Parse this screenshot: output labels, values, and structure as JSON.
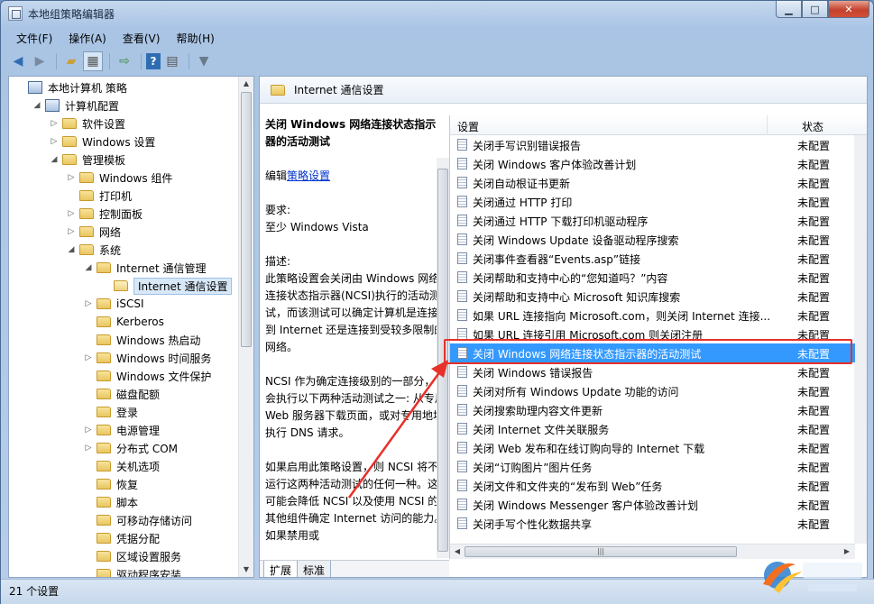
{
  "window": {
    "title": "本地组策略编辑器",
    "caption_buttons": [
      "minimize",
      "maximize",
      "close"
    ]
  },
  "menu": [
    "文件(F)",
    "操作(A)",
    "查看(V)",
    "帮助(H)"
  ],
  "toolbar": {
    "icons": [
      "back-icon",
      "forward-icon",
      "up-folder-icon",
      "show-tree-icon",
      "export-icon",
      "help-icon",
      "properties-icon",
      "filter-icon"
    ]
  },
  "tree": [
    {
      "label": "本地计算机 策略",
      "level": 0,
      "arrow": "",
      "icon": "computer"
    },
    {
      "label": "计算机配置",
      "level": 1,
      "arrow": "open",
      "icon": "computer"
    },
    {
      "label": "软件设置",
      "level": 2,
      "arrow": "closed",
      "icon": "folder"
    },
    {
      "label": "Windows 设置",
      "level": 2,
      "arrow": "closed",
      "icon": "folder"
    },
    {
      "label": "管理模板",
      "level": 2,
      "arrow": "open",
      "icon": "folder"
    },
    {
      "label": "Windows 组件",
      "level": 3,
      "arrow": "closed",
      "icon": "folder"
    },
    {
      "label": "打印机",
      "level": 3,
      "arrow": "",
      "icon": "folder"
    },
    {
      "label": "控制面板",
      "level": 3,
      "arrow": "closed",
      "icon": "folder"
    },
    {
      "label": "网络",
      "level": 3,
      "arrow": "closed",
      "icon": "folder"
    },
    {
      "label": "系统",
      "level": 3,
      "arrow": "open",
      "icon": "folder"
    },
    {
      "label": "Internet 通信管理",
      "level": 4,
      "arrow": "open",
      "icon": "folder"
    },
    {
      "label": "Internet 通信设置",
      "level": 5,
      "arrow": "",
      "icon": "folder-open",
      "selected": true
    },
    {
      "label": "iSCSI",
      "level": 4,
      "arrow": "closed",
      "icon": "folder"
    },
    {
      "label": "Kerberos",
      "level": 4,
      "arrow": "",
      "icon": "folder"
    },
    {
      "label": "Windows 热启动",
      "level": 4,
      "arrow": "",
      "icon": "folder"
    },
    {
      "label": "Windows 时间服务",
      "level": 4,
      "arrow": "closed",
      "icon": "folder"
    },
    {
      "label": "Windows 文件保护",
      "level": 4,
      "arrow": "",
      "icon": "folder"
    },
    {
      "label": "磁盘配额",
      "level": 4,
      "arrow": "",
      "icon": "folder"
    },
    {
      "label": "登录",
      "level": 4,
      "arrow": "",
      "icon": "folder"
    },
    {
      "label": "电源管理",
      "level": 4,
      "arrow": "closed",
      "icon": "folder"
    },
    {
      "label": "分布式 COM",
      "level": 4,
      "arrow": "closed",
      "icon": "folder"
    },
    {
      "label": "关机选项",
      "level": 4,
      "arrow": "",
      "icon": "folder"
    },
    {
      "label": "恢复",
      "level": 4,
      "arrow": "",
      "icon": "folder"
    },
    {
      "label": "脚本",
      "level": 4,
      "arrow": "",
      "icon": "folder"
    },
    {
      "label": "可移动存储访问",
      "level": 4,
      "arrow": "",
      "icon": "folder"
    },
    {
      "label": "凭据分配",
      "level": 4,
      "arrow": "",
      "icon": "folder"
    },
    {
      "label": "区域设置服务",
      "level": 4,
      "arrow": "",
      "icon": "folder"
    },
    {
      "label": "驱动程序安装",
      "level": 4,
      "arrow": "",
      "icon": "folder"
    }
  ],
  "right_header": "Internet 通信设置",
  "description": {
    "title": "关闭 Windows 网络连接状态指示器的活动测试",
    "edit_prefix": "编辑",
    "edit_link": "策略设置",
    "req_label": "要求:",
    "req_value": "至少 Windows Vista",
    "desc_label": "描述:",
    "para1": "此策略设置会关闭由 Windows 网络连接状态指示器(NCSI)执行的活动测试，而该测试可以确定计算机是连接到 Internet 还是连接到受较多限制的网络。",
    "para2": "NCSI 作为确定连接级别的一部分，会执行以下两种活动测试之一: 从专用 Web 服务器下载页面，或对专用地址执行 DNS 请求。",
    "para3": "如果启用此策略设置，则 NCSI 将不运行这两种活动测试的任何一种。这可能会降低 NCSI 以及使用 NCSI 的其他组件确定 Internet 访问的能力。如果禁用或"
  },
  "columns": {
    "setting": "设置",
    "state": "状态"
  },
  "settings": [
    {
      "name": "关闭手写识别错误报告",
      "state": "未配置"
    },
    {
      "name": "关闭 Windows 客户体验改善计划",
      "state": "未配置"
    },
    {
      "name": "关闭自动根证书更新",
      "state": "未配置"
    },
    {
      "name": "关闭通过 HTTP 打印",
      "state": "未配置"
    },
    {
      "name": "关闭通过 HTTP 下载打印机驱动程序",
      "state": "未配置"
    },
    {
      "name": "关闭 Windows Update 设备驱动程序搜索",
      "state": "未配置"
    },
    {
      "name": "关闭事件查看器“Events.asp”链接",
      "state": "未配置"
    },
    {
      "name": "关闭帮助和支持中心的“您知道吗？”内容",
      "state": "未配置"
    },
    {
      "name": "关闭帮助和支持中心 Microsoft 知识库搜索",
      "state": "未配置"
    },
    {
      "name": "如果 URL 连接指向 Microsoft.com，则关闭 Internet 连接...",
      "state": "未配置"
    },
    {
      "name": "如果 URL 连接引用 Microsoft.com 则关闭注册",
      "state": "未配置"
    },
    {
      "name": "关闭 Windows 网络连接状态指示器的活动测试",
      "state": "未配置",
      "selected": true
    },
    {
      "name": "关闭 Windows 错误报告",
      "state": "未配置"
    },
    {
      "name": "关闭对所有 Windows Update 功能的访问",
      "state": "未配置"
    },
    {
      "name": "关闭搜索助理内容文件更新",
      "state": "未配置"
    },
    {
      "name": "关闭 Internet 文件关联服务",
      "state": "未配置"
    },
    {
      "name": "关闭 Web 发布和在线订购向导的 Internet 下载",
      "state": "未配置"
    },
    {
      "name": "关闭“订购图片”图片任务",
      "state": "未配置"
    },
    {
      "name": "关闭文件和文件夹的“发布到 Web”任务",
      "state": "未配置"
    },
    {
      "name": "关闭 Windows Messenger 客户体验改善计划",
      "state": "未配置"
    },
    {
      "name": "关闭手写个性化数据共享",
      "state": "未配置"
    }
  ],
  "tabs": [
    "扩展",
    "标准"
  ],
  "status": "21 个设置",
  "colors": {
    "selection": "#3399ff",
    "highlight_box": "#e8302a",
    "link": "#0033cc"
  }
}
